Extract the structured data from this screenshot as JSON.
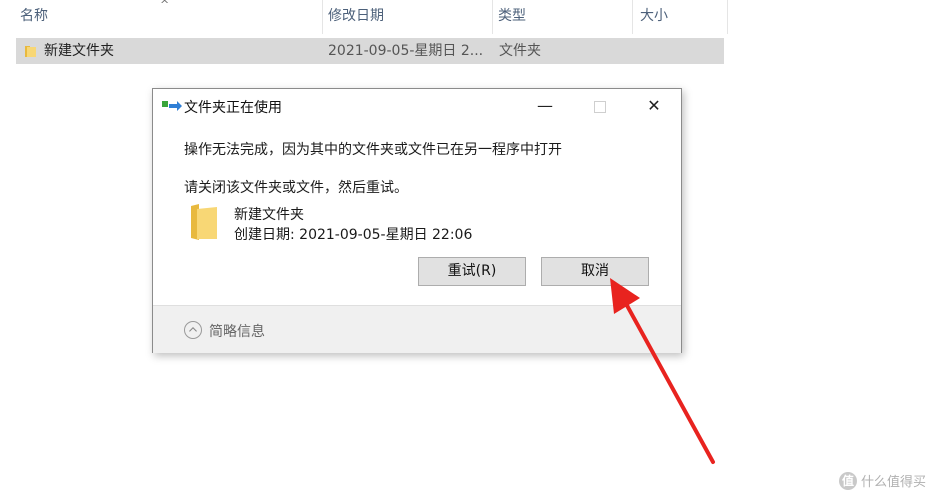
{
  "explorer": {
    "columns": {
      "name": "名称",
      "modified": "修改日期",
      "type": "类型",
      "size": "大小"
    },
    "sort_indicator": "^",
    "rows": [
      {
        "name": "新建文件夹",
        "modified": "2021-09-05-星期日 2...",
        "type": "文件夹",
        "icon": "folder-icon",
        "selected": true
      }
    ]
  },
  "dialog": {
    "title": "文件夹正在使用",
    "title_icon": "folder-in-use-icon",
    "window_controls": {
      "minimize": "—",
      "close": "✕"
    },
    "message_primary": "操作无法完成，因为其中的文件夹或文件已在另一程序中打开",
    "message_secondary": "请关闭该文件夹或文件，然后重试。",
    "file": {
      "name": "新建文件夹",
      "created": "创建日期: 2021-09-05-星期日 22:06",
      "icon": "folder-icon"
    },
    "buttons": {
      "retry": "重试(R)",
      "cancel": "取消"
    },
    "footer": {
      "toggle_label": "简略信息",
      "toggle_icon": "chevron-up-icon"
    }
  },
  "annotation": {
    "arrow_color": "#e8231f",
    "points_to": "cancel"
  },
  "watermark": {
    "badge": "值",
    "text": "什么值得买"
  },
  "colors": {
    "header_text": "#4c607a",
    "selection": "#d9d9d9",
    "button_face": "#e1e1e1",
    "footer_bg": "#f0f0f0",
    "folder_yellow": "#f8d775"
  }
}
